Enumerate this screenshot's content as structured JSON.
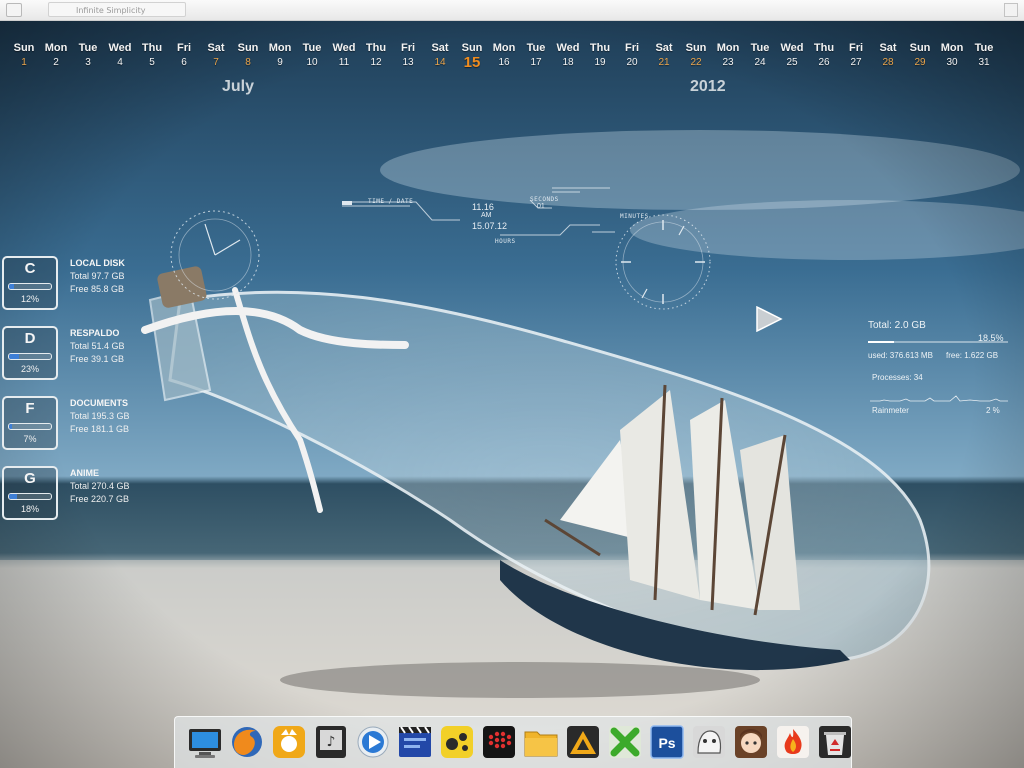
{
  "window": {
    "title": "Infinite Simplicity"
  },
  "calendar": {
    "month": "July",
    "year": "2012",
    "today": 15,
    "days": [
      {
        "dow": "Sun",
        "num": "1",
        "type": "weekend"
      },
      {
        "dow": "Mon",
        "num": "2",
        "type": "normal"
      },
      {
        "dow": "Tue",
        "num": "3",
        "type": "normal"
      },
      {
        "dow": "Wed",
        "num": "4",
        "type": "normal"
      },
      {
        "dow": "Thu",
        "num": "5",
        "type": "normal"
      },
      {
        "dow": "Fri",
        "num": "6",
        "type": "normal"
      },
      {
        "dow": "Sat",
        "num": "7",
        "type": "weekend"
      },
      {
        "dow": "Sun",
        "num": "8",
        "type": "weekend"
      },
      {
        "dow": "Mon",
        "num": "9",
        "type": "normal"
      },
      {
        "dow": "Tue",
        "num": "10",
        "type": "normal"
      },
      {
        "dow": "Wed",
        "num": "11",
        "type": "normal"
      },
      {
        "dow": "Thu",
        "num": "12",
        "type": "normal"
      },
      {
        "dow": "Fri",
        "num": "13",
        "type": "normal"
      },
      {
        "dow": "Sat",
        "num": "14",
        "type": "weekend"
      },
      {
        "dow": "Sun",
        "num": "15",
        "type": "today"
      },
      {
        "dow": "Mon",
        "num": "16",
        "type": "normal"
      },
      {
        "dow": "Tue",
        "num": "17",
        "type": "normal"
      },
      {
        "dow": "Wed",
        "num": "18",
        "type": "normal"
      },
      {
        "dow": "Thu",
        "num": "19",
        "type": "normal"
      },
      {
        "dow": "Fri",
        "num": "20",
        "type": "normal"
      },
      {
        "dow": "Sat",
        "num": "21",
        "type": "weekend"
      },
      {
        "dow": "Sun",
        "num": "22",
        "type": "weekend"
      },
      {
        "dow": "Mon",
        "num": "23",
        "type": "normal"
      },
      {
        "dow": "Tue",
        "num": "24",
        "type": "normal"
      },
      {
        "dow": "Wed",
        "num": "25",
        "type": "normal"
      },
      {
        "dow": "Thu",
        "num": "26",
        "type": "normal"
      },
      {
        "dow": "Fri",
        "num": "27",
        "type": "normal"
      },
      {
        "dow": "Sat",
        "num": "28",
        "type": "weekend"
      },
      {
        "dow": "Sun",
        "num": "29",
        "type": "weekend"
      },
      {
        "dow": "Mon",
        "num": "30",
        "type": "normal"
      },
      {
        "dow": "Tue",
        "num": "31",
        "type": "normal"
      }
    ]
  },
  "clock_widget": {
    "label_time_date": "TIME / DATE",
    "time": "11.16",
    "ampm": "AM",
    "date": "15.07.12",
    "label_seconds": "SECONDS",
    "seconds": "01",
    "label_minutes": "MINUTES",
    "label_hours": "HOURS"
  },
  "drives": [
    {
      "letter": "C",
      "name": "LOCAL DISK",
      "total": "Total 97.7 GB",
      "free": "Free 85.8 GB",
      "percent_label": "12%",
      "percent": 12
    },
    {
      "letter": "D",
      "name": "RESPALDO",
      "total": "Total 51.4 GB",
      "free": "Free 39.1 GB",
      "percent_label": "23%",
      "percent": 23
    },
    {
      "letter": "F",
      "name": "DOCUMENTS",
      "total": "Total 195.3 GB",
      "free": "Free 181.1 GB",
      "percent_label": "7%",
      "percent": 7
    },
    {
      "letter": "G",
      "name": "ANIME",
      "total": "Total 270.4 GB",
      "free": "Free 220.7 GB",
      "percent_label": "18%",
      "percent": 18
    }
  ],
  "system_monitor": {
    "ram_total": "Total: 2.0 GB",
    "ram_percent_label": "18.5%",
    "ram_percent": 18.5,
    "ram_used": "used: 376.613 MB",
    "ram_free": "free: 1.622 GB",
    "processes": "Processes: 34",
    "cpu_process_name": "Rainmeter",
    "cpu_process_percent": "2 %"
  },
  "dock": {
    "icons": [
      {
        "name": "my-computer-icon"
      },
      {
        "name": "firefox-icon"
      },
      {
        "name": "gom-player-icon"
      },
      {
        "name": "itunes-icon"
      },
      {
        "name": "media-player-icon"
      },
      {
        "name": "video-editor-icon"
      },
      {
        "name": "game-controller-icon"
      },
      {
        "name": "dots-app-icon"
      },
      {
        "name": "folder-icon"
      },
      {
        "name": "warning-app-icon"
      },
      {
        "name": "green-x-app-icon"
      },
      {
        "name": "photoshop-icon"
      },
      {
        "name": "anime-character-icon"
      },
      {
        "name": "anime-girl-icon"
      },
      {
        "name": "flame-app-icon"
      },
      {
        "name": "recycle-bin-icon"
      }
    ],
    "photoshop_label": "Ps"
  },
  "colors": {
    "accent_today": "#f08c1e",
    "weekend": "#e9a44b",
    "drive_fill": "#3e7fd6"
  }
}
